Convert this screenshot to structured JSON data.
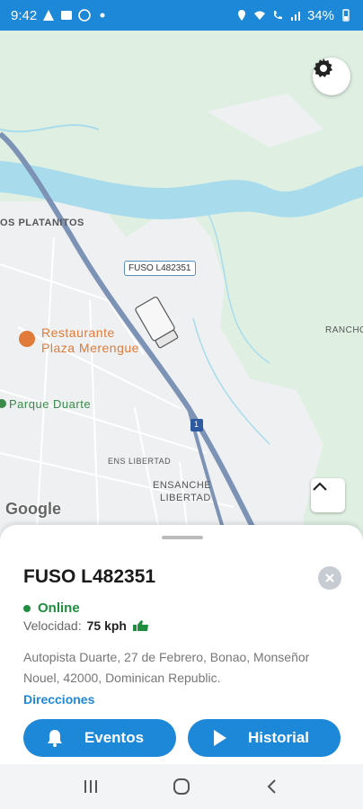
{
  "status_bar": {
    "time": "9:42",
    "battery": "34%"
  },
  "map": {
    "labels": {
      "platanitos": "OS PLATANITOS",
      "rancho": "RANCHO",
      "ens_libertad": "ENS LIBERTAD",
      "ensanche_libertad_1": "ENSANCHE",
      "ensanche_libertad_2": "LIBERTAD",
      "restaurant_1": "Restaurante",
      "restaurant_2": "Plaza Merengue",
      "park": "Parque Duarte",
      "highway_shield": "1",
      "google": "Google"
    },
    "vehicle_tag": "FUSO L482351",
    "colors": {
      "land": "#dff0e3",
      "urban": "#eef0f2",
      "water": "#a8dcec",
      "highway": "#7d93b5",
      "poi_orange": "#e07b39",
      "park_green": "#3a8a4a"
    }
  },
  "sheet": {
    "vehicle_name": "FUSO L482351",
    "status": "Online",
    "speed_label": "Velocidad:",
    "speed_value": "75 kph",
    "address": "Autopista Duarte, 27 de Febrero, Bonao, Monseñor Nouel, 42000, Dominican Republic.",
    "directions": "Direcciones",
    "events_button": "Eventos",
    "history_button": "Historial",
    "colors": {
      "primary": "#1e88d8",
      "online": "#1e8e3e"
    }
  },
  "icons": {
    "settings": "gear-icon",
    "collapse": "chevron-up-icon",
    "close": "close-icon",
    "events": "bell-icon",
    "history": "play-icon",
    "speed": "thumbs-up-icon"
  }
}
